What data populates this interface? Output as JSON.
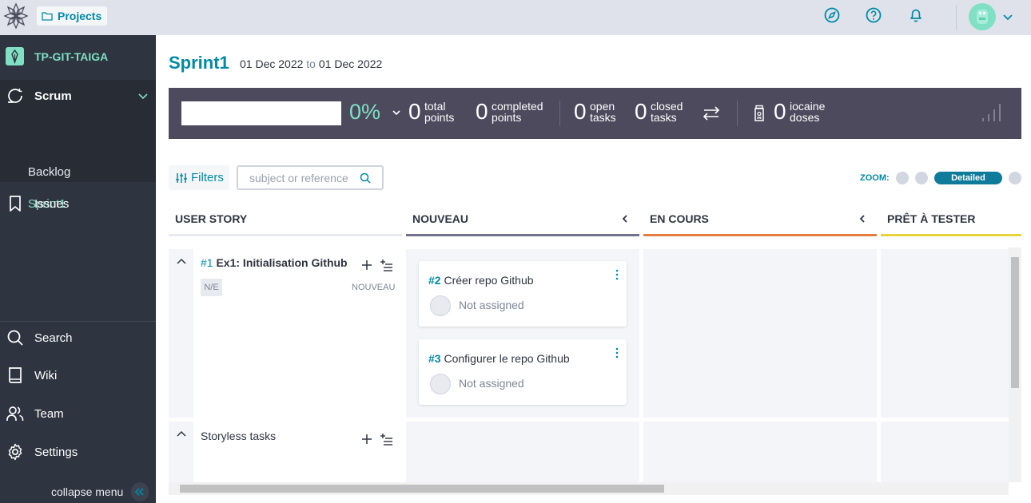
{
  "topbar": {
    "projects_label": "Projects",
    "icons": [
      "discover-icon",
      "help-icon",
      "notifications-icon",
      "avatar",
      "chevron-down-icon"
    ]
  },
  "sidebar": {
    "project_name": "TP-GIT-TAIGA",
    "scrum_label": "Scrum",
    "backlog_label": "Backlog",
    "sprint_label": "Sprint1",
    "issues_label": "Issues",
    "search_label": "Search",
    "wiki_label": "Wiki",
    "team_label": "Team",
    "settings_label": "Settings",
    "collapse_label": "collapse menu"
  },
  "sprint": {
    "title": "Sprint1",
    "start_date": "01 Dec 2022",
    "to_label": "to",
    "end_date": "01 Dec 2022"
  },
  "stats": {
    "progress_fraction": 0,
    "percent_label": "0%",
    "total_points": "0",
    "total_points_label_1": "total",
    "total_points_label_2": "points",
    "completed_points": "0",
    "completed_points_label_1": "completed",
    "completed_points_label_2": "points",
    "open_tasks": "0",
    "open_tasks_label_1": "open",
    "open_tasks_label_2": "tasks",
    "closed_tasks": "0",
    "closed_tasks_label_1": "closed",
    "closed_tasks_label_2": "tasks",
    "iocaine_doses": "0",
    "iocaine_label_1": "iocaine",
    "iocaine_label_2": "doses"
  },
  "filters": {
    "label": "Filters",
    "search_placeholder": "subject or reference"
  },
  "zoom": {
    "label": "ZOOM:",
    "active_level": "Detailed"
  },
  "board": {
    "columns": [
      {
        "title": "USER STORY",
        "color": "#e8eaef"
      },
      {
        "title": "NOUVEAU",
        "color": "#70728f"
      },
      {
        "title": "EN COURS",
        "color": "#e47c40"
      },
      {
        "title": "PRÊT À TESTER",
        "color": "#e8d43a"
      }
    ],
    "user_story": {
      "ref": "#1",
      "title": "Ex1: Initialisation Github",
      "points": "N/E",
      "status": "NOUVEAU"
    },
    "tasks": [
      {
        "ref": "#2",
        "title": "Créer repo Github",
        "assignee": "Not assigned"
      },
      {
        "ref": "#3",
        "title": "Configurer le repo Github",
        "assignee": "Not assigned"
      }
    ],
    "storyless_label": "Storyless tasks"
  },
  "colors": {
    "accent": "#008aa8",
    "brand_green": "#7fe0c3",
    "sidebar_bg": "#2e3440",
    "stats_bg": "#4c4a5c"
  }
}
